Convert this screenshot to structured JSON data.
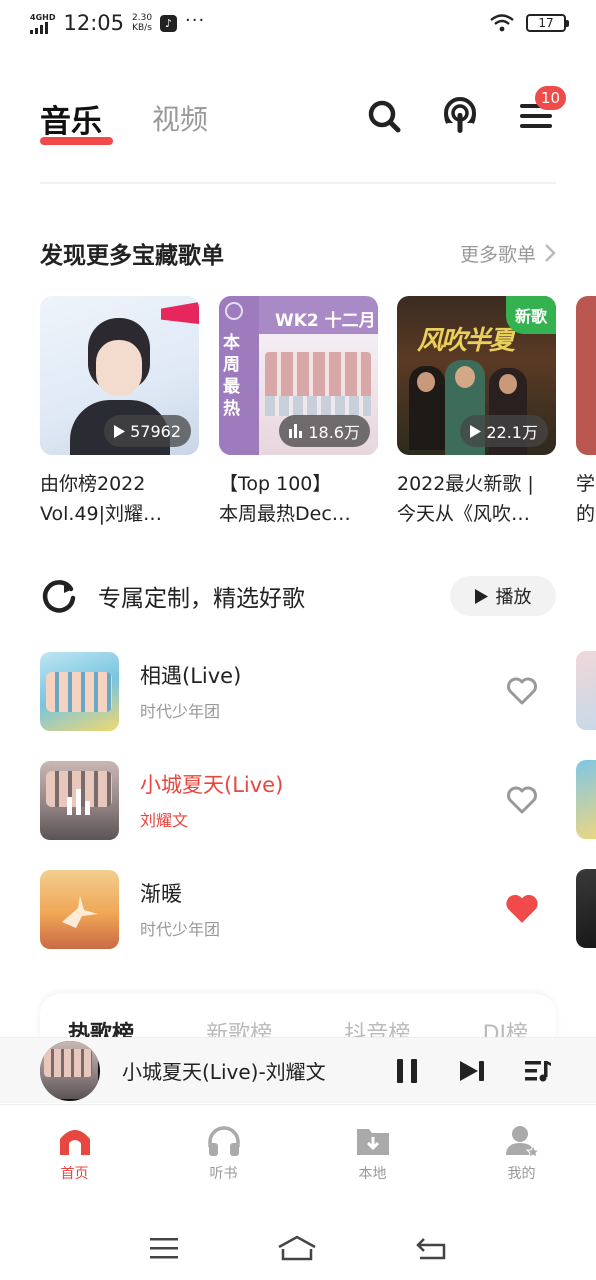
{
  "status_bar": {
    "network": "4GHD",
    "time": "12:05",
    "speed_value": "2.30",
    "speed_unit": "KB/s",
    "battery": "17"
  },
  "header": {
    "tab_music": "音乐",
    "tab_video": "视频",
    "menu_badge": "10",
    "accent_color": "#f04a4a"
  },
  "discover": {
    "title": "发现更多宝藏歌单",
    "more_label": "更多歌单",
    "playlists": [
      {
        "title": "由你榜2022\nVol.49|刘耀…",
        "play_count": "57962"
      },
      {
        "title": "【Top 100】\n本周最热Dec…",
        "play_count": "18.6万",
        "cover_heading": "WK2 十二月",
        "cover_side": "本周最热"
      },
      {
        "title": "2022最火新歌 |\n今天从《风吹…",
        "play_count": "22.1万",
        "badge": "新歌"
      },
      {
        "title": "学\n的"
      }
    ]
  },
  "custom": {
    "title": "专属定制，精选好歌",
    "play_label": "播放",
    "songs": [
      {
        "title": "相遇(Live)",
        "artist": "时代少年团",
        "liked": false
      },
      {
        "title": "小城夏天(Live)",
        "artist": "刘耀文",
        "liked": false,
        "playing": true
      },
      {
        "title": "渐暖",
        "artist": "时代少年团",
        "liked": true
      }
    ]
  },
  "charts": {
    "tabs": [
      "热歌榜",
      "新歌榜",
      "抖音榜",
      "DJ榜"
    ]
  },
  "player": {
    "now_playing": "小城夏天(Live)-刘耀文"
  },
  "bottom_nav": {
    "items": [
      {
        "label": "首页",
        "icon": "home-icon",
        "active": true
      },
      {
        "label": "听书",
        "icon": "headphones-icon"
      },
      {
        "label": "本地",
        "icon": "local-folder-icon"
      },
      {
        "label": "我的",
        "icon": "user-icon"
      }
    ]
  }
}
